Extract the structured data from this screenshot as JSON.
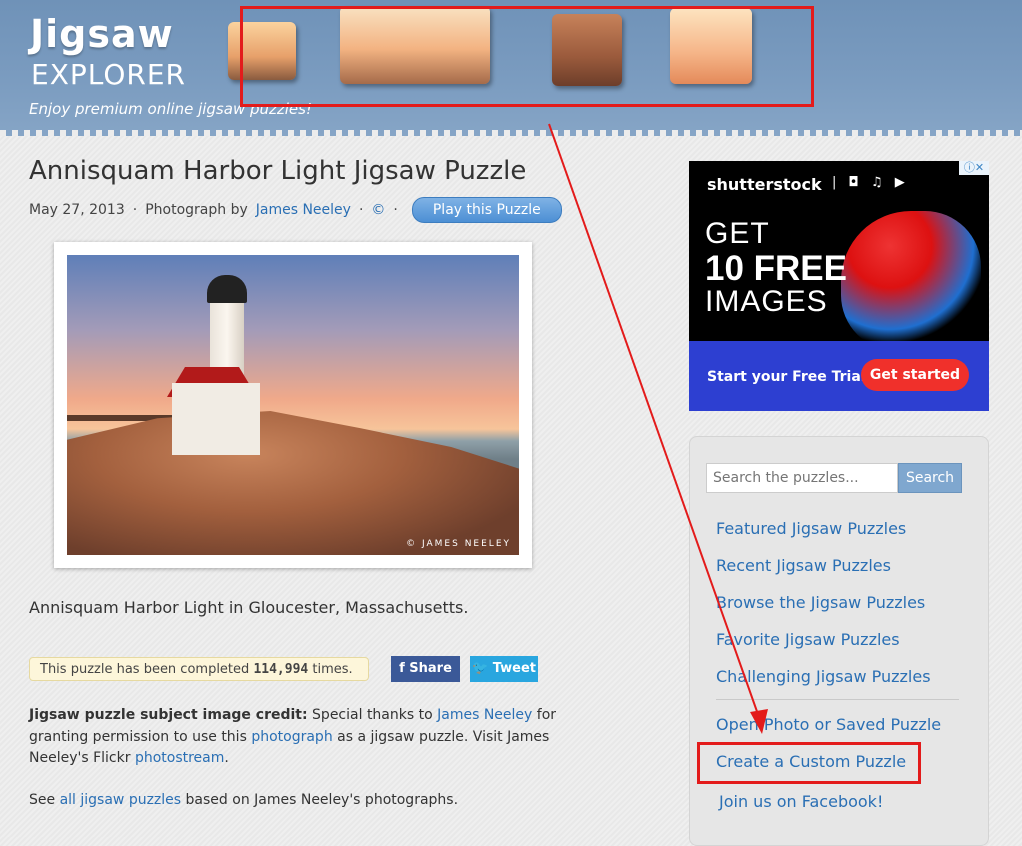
{
  "header": {
    "logo_word": "Jigsaw",
    "logo_sub": "EXPLORER",
    "tagline": "Enjoy premium online jigsaw puzzles!"
  },
  "puzzle": {
    "title": "Annisquam Harbor Light Jigsaw Puzzle",
    "date": "May 27, 2013",
    "dot": "·",
    "photo_by_label": "Photograph by",
    "photographer": "James Neeley",
    "copyright": "©",
    "play_label": "Play this Puzzle",
    "watermark": "© JAMES NEELEY",
    "caption": "Annisquam Harbor Light in Gloucester, Massachusetts."
  },
  "stats": {
    "completed_prefix": "This puzzle has been completed",
    "completed_count": "114,994",
    "completed_suffix": "times."
  },
  "social": {
    "share_label": "Share",
    "tweet_label": "Tweet",
    "share_icon": "facebook-icon",
    "tweet_icon": "twitter-icon"
  },
  "credit": {
    "heading": "Jigsaw puzzle subject image credit:",
    "text1": "Special thanks to",
    "link1": "James Neeley",
    "text2": "for granting permission to use this",
    "link2": "photograph",
    "text3": "as a jigsaw puzzle. Visit James Neeley's Flickr",
    "link3": "photostream",
    "text4": "."
  },
  "see_also": {
    "prefix": "See",
    "link": "all jigsaw puzzles",
    "suffix": "based on James Neeley's photographs."
  },
  "ad": {
    "brand": "shutterstock",
    "icons_text": "| ◘ ♫ ▶",
    "adchoices": "ⓘ✕",
    "line1": "GET",
    "line2": "10 FREE",
    "line3": "IMAGES",
    "trial_text": "Start your Free Trial",
    "cta": "Get started"
  },
  "sidebar": {
    "search_placeholder": "Search the puzzles...",
    "search_button": "Search",
    "links": [
      "Featured Jigsaw Puzzles",
      "Recent Jigsaw Puzzles",
      "Browse the Jigsaw Puzzles",
      "Favorite Jigsaw Puzzles",
      "Challenging Jigsaw Puzzles"
    ],
    "links2": [
      "Open Photo or Saved Puzzle",
      "Create a Custom Puzzle",
      "Join us on Facebook!"
    ]
  },
  "annotation": {
    "color": "#e31b1b"
  }
}
